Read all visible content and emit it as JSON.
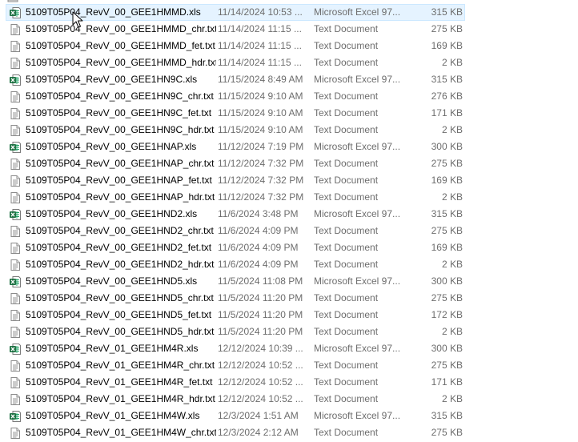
{
  "colors": {
    "selection_bg": "#e5f3ff",
    "selection_border": "#cce8ff",
    "excel_green": "#1f7244",
    "detail_text": "#6d6d6d"
  },
  "files": [
    {
      "name": "5109T05P04_RevV_00_GEE1HMMD.xls",
      "date": "11/14/2024 10:53 ...",
      "type": "Microsoft Excel 97...",
      "size": "315 KB",
      "icon": "excel-file-icon",
      "selected": true
    },
    {
      "name": "5109T05P04_RevV_00_GEE1HMMD_chr.txt",
      "date": "11/14/2024 11:15 ...",
      "type": "Text Document",
      "size": "275 KB",
      "icon": "text-file-icon"
    },
    {
      "name": "5109T05P04_RevV_00_GEE1HMMD_fet.txt",
      "date": "11/14/2024 11:15 ...",
      "type": "Text Document",
      "size": "169 KB",
      "icon": "text-file-icon"
    },
    {
      "name": "5109T05P04_RevV_00_GEE1HMMD_hdr.txt",
      "date": "11/14/2024 11:15 ...",
      "type": "Text Document",
      "size": "2 KB",
      "icon": "text-file-icon"
    },
    {
      "name": "5109T05P04_RevV_00_GEE1HN9C.xls",
      "date": "11/15/2024 8:49 AM",
      "type": "Microsoft Excel 97...",
      "size": "315 KB",
      "icon": "excel-file-icon"
    },
    {
      "name": "5109T05P04_RevV_00_GEE1HN9C_chr.txt",
      "date": "11/15/2024 9:10 AM",
      "type": "Text Document",
      "size": "276 KB",
      "icon": "text-file-icon"
    },
    {
      "name": "5109T05P04_RevV_00_GEE1HN9C_fet.txt",
      "date": "11/15/2024 9:10 AM",
      "type": "Text Document",
      "size": "171 KB",
      "icon": "text-file-icon"
    },
    {
      "name": "5109T05P04_RevV_00_GEE1HN9C_hdr.txt",
      "date": "11/15/2024 9:10 AM",
      "type": "Text Document",
      "size": "2 KB",
      "icon": "text-file-icon"
    },
    {
      "name": "5109T05P04_RevV_00_GEE1HNAP.xls",
      "date": "11/12/2024 7:19 PM",
      "type": "Microsoft Excel 97...",
      "size": "300 KB",
      "icon": "excel-file-icon"
    },
    {
      "name": "5109T05P04_RevV_00_GEE1HNAP_chr.txt",
      "date": "11/12/2024 7:32 PM",
      "type": "Text Document",
      "size": "275 KB",
      "icon": "text-file-icon"
    },
    {
      "name": "5109T05P04_RevV_00_GEE1HNAP_fet.txt",
      "date": "11/12/2024 7:32 PM",
      "type": "Text Document",
      "size": "169 KB",
      "icon": "text-file-icon"
    },
    {
      "name": "5109T05P04_RevV_00_GEE1HNAP_hdr.txt",
      "date": "11/12/2024 7:32 PM",
      "type": "Text Document",
      "size": "2 KB",
      "icon": "text-file-icon"
    },
    {
      "name": "5109T05P04_RevV_00_GEE1HND2.xls",
      "date": "11/6/2024 3:48 PM",
      "type": "Microsoft Excel 97...",
      "size": "315 KB",
      "icon": "excel-file-icon"
    },
    {
      "name": "5109T05P04_RevV_00_GEE1HND2_chr.txt",
      "date": "11/6/2024 4:09 PM",
      "type": "Text Document",
      "size": "275 KB",
      "icon": "text-file-icon"
    },
    {
      "name": "5109T05P04_RevV_00_GEE1HND2_fet.txt",
      "date": "11/6/2024 4:09 PM",
      "type": "Text Document",
      "size": "169 KB",
      "icon": "text-file-icon"
    },
    {
      "name": "5109T05P04_RevV_00_GEE1HND2_hdr.txt",
      "date": "11/6/2024 4:09 PM",
      "type": "Text Document",
      "size": "2 KB",
      "icon": "text-file-icon"
    },
    {
      "name": "5109T05P04_RevV_00_GEE1HND5.xls",
      "date": "11/5/2024 11:08 PM",
      "type": "Microsoft Excel 97...",
      "size": "300 KB",
      "icon": "excel-file-icon"
    },
    {
      "name": "5109T05P04_RevV_00_GEE1HND5_chr.txt",
      "date": "11/5/2024 11:20 PM",
      "type": "Text Document",
      "size": "275 KB",
      "icon": "text-file-icon"
    },
    {
      "name": "5109T05P04_RevV_00_GEE1HND5_fet.txt",
      "date": "11/5/2024 11:20 PM",
      "type": "Text Document",
      "size": "172 KB",
      "icon": "text-file-icon"
    },
    {
      "name": "5109T05P04_RevV_00_GEE1HND5_hdr.txt",
      "date": "11/5/2024 11:20 PM",
      "type": "Text Document",
      "size": "2 KB",
      "icon": "text-file-icon"
    },
    {
      "name": "5109T05P04_RevV_01_GEE1HM4R.xls",
      "date": "12/12/2024 10:39 ...",
      "type": "Microsoft Excel 97...",
      "size": "300 KB",
      "icon": "excel-file-icon"
    },
    {
      "name": "5109T05P04_RevV_01_GEE1HM4R_chr.txt",
      "date": "12/12/2024 10:52 ...",
      "type": "Text Document",
      "size": "275 KB",
      "icon": "text-file-icon"
    },
    {
      "name": "5109T05P04_RevV_01_GEE1HM4R_fet.txt",
      "date": "12/12/2024 10:52 ...",
      "type": "Text Document",
      "size": "171 KB",
      "icon": "text-file-icon"
    },
    {
      "name": "5109T05P04_RevV_01_GEE1HM4R_hdr.txt",
      "date": "12/12/2024 10:52 ...",
      "type": "Text Document",
      "size": "2 KB",
      "icon": "text-file-icon"
    },
    {
      "name": "5109T05P04_RevV_01_GEE1HM4W.xls",
      "date": "12/3/2024 1:51 AM",
      "type": "Microsoft Excel 97...",
      "size": "315 KB",
      "icon": "excel-file-icon"
    },
    {
      "name": "5109T05P04_RevV_01_GEE1HM4W_chr.txt",
      "date": "12/3/2024 2:12 AM",
      "type": "Text Document",
      "size": "275 KB",
      "icon": "text-file-icon"
    }
  ]
}
